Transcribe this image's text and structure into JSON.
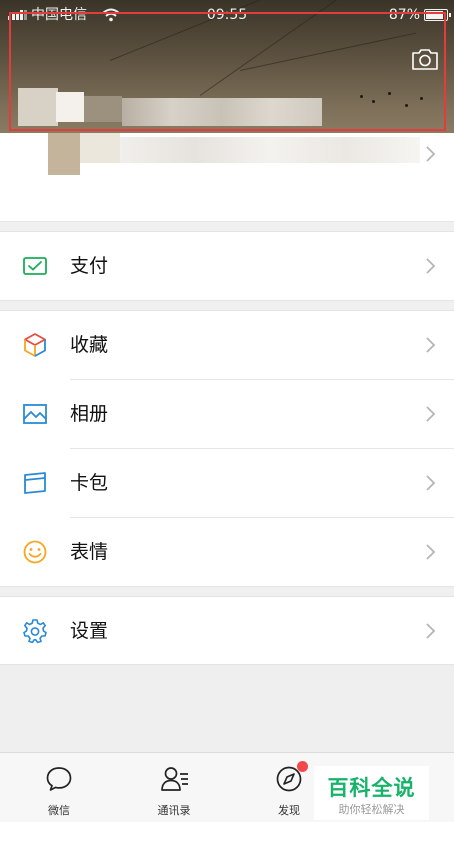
{
  "status_bar": {
    "carrier": "中国电信",
    "time": "09:55",
    "battery": "87%",
    "battery_level": 0.87
  },
  "header": {
    "camera_icon": "camera-icon"
  },
  "menu": {
    "pay": {
      "label": "支付",
      "icon": "wallet-check-icon",
      "accent": "#1aad5a"
    },
    "favorites": {
      "label": "收藏",
      "icon": "cube-icon",
      "accent": "#e84c3d"
    },
    "album": {
      "label": "相册",
      "icon": "image-icon",
      "accent": "#2a8ad6"
    },
    "cards": {
      "label": "卡包",
      "icon": "card-icon",
      "accent": "#2a8ad6"
    },
    "stickers": {
      "label": "表情",
      "icon": "smiley-icon",
      "accent": "#f5a623"
    },
    "settings": {
      "label": "设置",
      "icon": "gear-icon",
      "accent": "#2a8ad6"
    }
  },
  "tabs": [
    {
      "label": "微信",
      "icon": "chat-bubble-icon"
    },
    {
      "label": "通讯录",
      "icon": "contacts-icon"
    },
    {
      "label": "发现",
      "icon": "compass-icon",
      "badge": true
    }
  ],
  "watermark": {
    "title": "百科全说",
    "subtitle": "助你轻松解决"
  }
}
